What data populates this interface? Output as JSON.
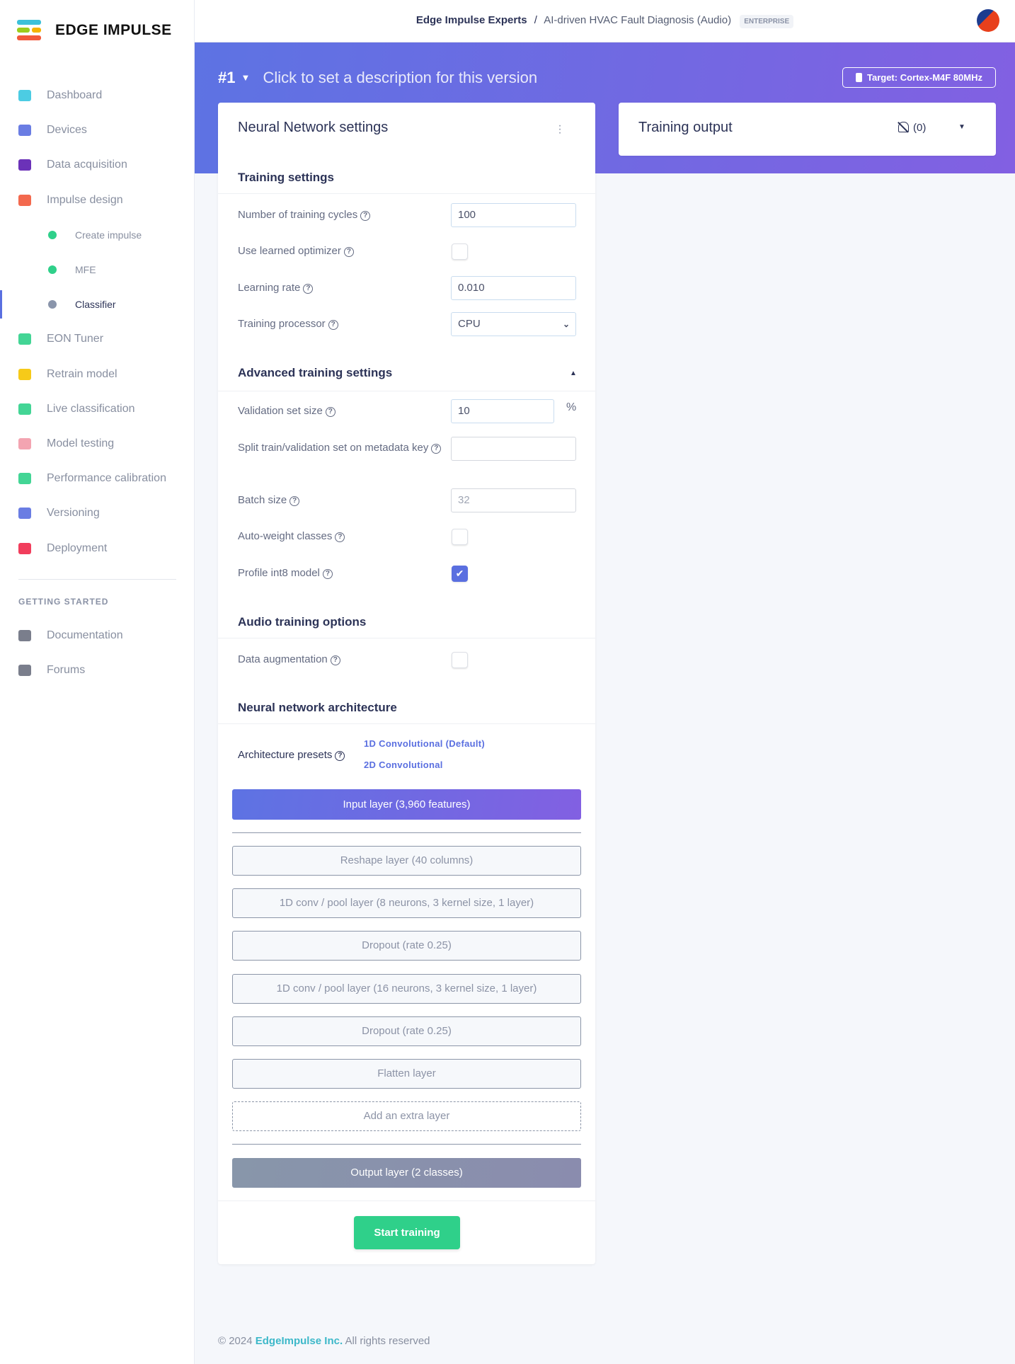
{
  "brand": {
    "name": "EDGE IMPULSE",
    "colors": [
      "#3cc1d9",
      "#9ccd1c",
      "#f5b301",
      "#f2593b"
    ]
  },
  "sidebar": {
    "items": [
      {
        "label": "Dashboard",
        "icon": "monitor-icon",
        "color": "#39c7e0"
      },
      {
        "label": "Devices",
        "icon": "chip-icon",
        "color": "#5a6fe0"
      },
      {
        "label": "Data acquisition",
        "icon": "database-icon",
        "color": "#5b1cb0"
      },
      {
        "label": "Impulse design",
        "icon": "pulse-icon",
        "color": "#f2593b"
      },
      {
        "label": "Create impulse",
        "icon": "status-dot-icon",
        "color": "#2fd08a",
        "sub": true
      },
      {
        "label": "MFE",
        "icon": "status-dot-icon",
        "color": "#2fd08a",
        "sub": true
      },
      {
        "label": "Classifier",
        "icon": "status-dot-icon",
        "color": "#8a95ab",
        "sub": true,
        "active": true
      },
      {
        "label": "EON Tuner",
        "icon": "compass-icon",
        "color": "#2fd08a"
      },
      {
        "label": "Retrain model",
        "icon": "shuffle-icon",
        "color": "#f5c400"
      },
      {
        "label": "Live classification",
        "icon": "bezier-icon",
        "color": "#2fd08a"
      },
      {
        "label": "Model testing",
        "icon": "clipboard-check-icon",
        "color": "#f29aa8"
      },
      {
        "label": "Performance calibration",
        "icon": "factory-icon",
        "color": "#2fd08a"
      },
      {
        "label": "Versioning",
        "icon": "branch-icon",
        "color": "#5a6fe0"
      },
      {
        "label": "Deployment",
        "icon": "box-icon",
        "color": "#f0284a"
      }
    ],
    "section_title": "GETTING STARTED",
    "help": [
      {
        "label": "Documentation",
        "icon": "rocket-icon",
        "color": "#6b7080"
      },
      {
        "label": "Forums",
        "icon": "chat-icon",
        "color": "#6b7080"
      }
    ]
  },
  "header": {
    "org": "Edge Impulse Experts",
    "separator": "/",
    "project": "AI-driven HVAC Fault Diagnosis (Audio)",
    "badge": "ENTERPRISE"
  },
  "version": {
    "number": "#1",
    "description": "Click to set a description for this version",
    "target": "Target: Cortex-M4F 80MHz"
  },
  "nn_card": {
    "title": "Neural Network settings",
    "training_settings": "Training settings",
    "fields": {
      "cycles": {
        "label": "Number of training cycles",
        "value": "100"
      },
      "learned_optimizer": {
        "label": "Use learned optimizer",
        "checked": false
      },
      "learning_rate": {
        "label": "Learning rate",
        "value": "0.010"
      },
      "processor": {
        "label": "Training processor",
        "value": "CPU"
      },
      "validation": {
        "label": "Validation set size",
        "value": "10",
        "unit": "%"
      },
      "split_key": {
        "label": "Split train/validation set on metadata key",
        "value": ""
      },
      "batch": {
        "label": "Batch size",
        "placeholder": "32"
      },
      "auto_weight": {
        "label": "Auto-weight classes",
        "checked": false
      },
      "profile_int8": {
        "label": "Profile int8 model",
        "checked": true
      },
      "augmentation": {
        "label": "Data augmentation",
        "checked": false
      }
    },
    "advanced": "Advanced training settings",
    "audio": "Audio training options",
    "architecture": "Neural network architecture",
    "presets_label": "Architecture presets",
    "presets": [
      "1D Convolutional (Default)",
      "2D Convolutional"
    ],
    "input_layer": "Input layer (3,960 features)",
    "layers": [
      "Reshape layer (40 columns)",
      "1D conv / pool layer (8 neurons, 3 kernel size, 1 layer)",
      "Dropout (rate 0.25)",
      "1D conv / pool layer (16 neurons, 3 kernel size, 1 layer)",
      "Dropout (rate 0.25)",
      "Flatten layer"
    ],
    "add_layer": "Add an extra layer",
    "output_layer": "Output layer (2 classes)",
    "start": "Start training"
  },
  "output_card": {
    "title": "Training output",
    "notifications": "(0)"
  },
  "footer": {
    "copyright": "© 2024",
    "company": "EdgeImpulse Inc.",
    "rights": "All rights reserved"
  }
}
